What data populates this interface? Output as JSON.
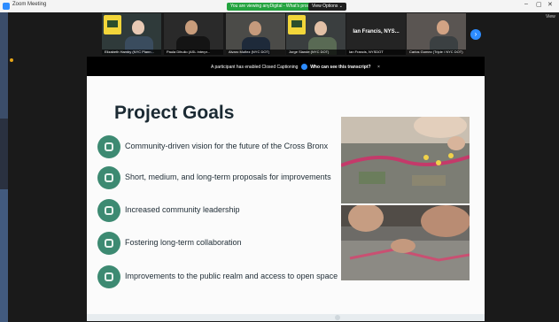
{
  "window": {
    "title": "Zoom Meeting",
    "side_label": "View",
    "minimize": "–",
    "maximize": "▢",
    "close": "✕"
  },
  "banner": {
    "viewing": "You are viewing anyDigital - What's process",
    "view_options": "View Options ⌄"
  },
  "participants": [
    {
      "name": "Elizabeth Hamby (NYC Plann..."
    },
    {
      "name": "Paula Dihulio (ASL Interpr..."
    },
    {
      "name": "Alvaro Muñez (NYC DOT)"
    },
    {
      "name": "Jorge Slande (NYC DOT)"
    },
    {
      "name": "Ian Francis, NYSDOT",
      "big": "Ian Francis, NYS..."
    },
    {
      "name": "Carlos Gomez (Triple / NYC DOT)"
    }
  ],
  "captioning": {
    "notice": "A participant has enabled Closed Captioning",
    "link": "Who can see this transcript?",
    "close": "×"
  },
  "slide": {
    "title": "Project Goals",
    "goals": [
      {
        "text": "Community-driven vision for the future of the Cross Bronx",
        "icon": "community-icon"
      },
      {
        "text": "Short, medium, and long-term proposals for improvements",
        "icon": "lightbulb-icon"
      },
      {
        "text": "Increased community leadership",
        "icon": "leadership-icon"
      },
      {
        "text": "Fostering long-term collaboration",
        "icon": "collaboration-icon"
      },
      {
        "text": "Improvements to the public realm and access to open space",
        "icon": "open-space-icon"
      }
    ]
  },
  "colors": {
    "goal_icon": "#3d8a72",
    "accent": "#2d8cff",
    "banner_green": "#23a33f"
  }
}
